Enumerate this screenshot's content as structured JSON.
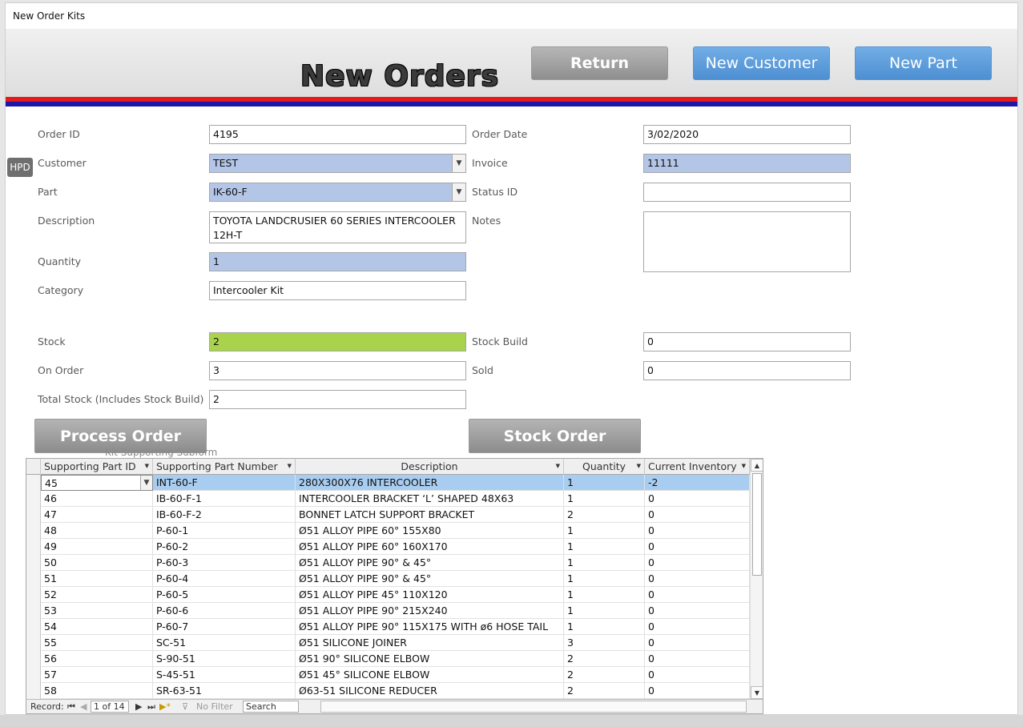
{
  "window": {
    "title": "New Order Kits"
  },
  "header": {
    "title": "New Orders",
    "buttons": {
      "return": "Return",
      "new_customer": "New Customer",
      "new_part": "New Part"
    }
  },
  "side_tab": "HPD",
  "form": {
    "order_id": {
      "label": "Order ID",
      "value": "4195"
    },
    "order_date": {
      "label": "Order Date",
      "value": "3/02/2020"
    },
    "customer": {
      "label": "Customer",
      "value": "TEST"
    },
    "invoice": {
      "label": "Invoice",
      "value": "11111"
    },
    "part": {
      "label": "Part",
      "value": "IK-60-F"
    },
    "status_id": {
      "label": "Status ID",
      "value": ""
    },
    "description": {
      "label": "Description",
      "value": "TOYOTA LANDCRUSIER 60 SERIES INTERCOOLER 12H-T"
    },
    "notes": {
      "label": "Notes",
      "value": ""
    },
    "quantity": {
      "label": "Quantity",
      "value": "1"
    },
    "category": {
      "label": "Category",
      "value": "Intercooler Kit"
    },
    "stock": {
      "label": "Stock",
      "value": "2"
    },
    "stock_build": {
      "label": "Stock Build",
      "value": "0"
    },
    "on_order": {
      "label": "On Order",
      "value": "3"
    },
    "sold": {
      "label": "Sold",
      "value": "0"
    },
    "total_stock": {
      "label": "Total Stock (Includes Stock Build)",
      "value": "2"
    }
  },
  "actions": {
    "process_order": "Process Order",
    "stock_order": "Stock Order"
  },
  "subform": {
    "caption": "Kit Supporting Subform",
    "columns": [
      "Supporting Part ID",
      "Supporting Part Number",
      "Description",
      "Quantity",
      "Current Inventory"
    ],
    "rows": [
      [
        "45",
        "INT-60-F",
        "280X300X76 INTERCOOLER",
        "1",
        "-2"
      ],
      [
        "46",
        "IB-60-F-1",
        "INTERCOOLER BRACKET ‘L’ SHAPED 48X63",
        "1",
        "0"
      ],
      [
        "47",
        "IB-60-F-2",
        "BONNET LATCH SUPPORT BRACKET",
        "2",
        "0"
      ],
      [
        "48",
        "P-60-1",
        "Ø51 ALLOY PIPE 60° 155X80",
        "1",
        "0"
      ],
      [
        "49",
        "P-60-2",
        "Ø51 ALLOY PIPE 60° 160X170",
        "1",
        "0"
      ],
      [
        "50",
        "P-60-3",
        "Ø51 ALLOY PIPE 90° & 45°",
        "1",
        "0"
      ],
      [
        "51",
        "P-60-4",
        "Ø51 ALLOY PIPE 90° & 45°",
        "1",
        "0"
      ],
      [
        "52",
        "P-60-5",
        "Ø51 ALLOY PIPE 45° 110X120",
        "1",
        "0"
      ],
      [
        "53",
        "P-60-6",
        "Ø51 ALLOY PIPE 90° 215X240",
        "1",
        "0"
      ],
      [
        "54",
        "P-60-7",
        "Ø51 ALLOY PIPE 90° 115X175 WITH ø6 HOSE TAIL",
        "1",
        "0"
      ],
      [
        "55",
        "SC-51",
        "Ø51 SILICONE JOINER",
        "3",
        "0"
      ],
      [
        "56",
        "S-90-51",
        "Ø51 90° SILICONE ELBOW",
        "2",
        "0"
      ],
      [
        "57",
        "S-45-51",
        "Ø51 45° SILICONE ELBOW",
        "2",
        "0"
      ],
      [
        "58",
        "SR-63-51",
        "Ø63-51 SILICONE REDUCER",
        "2",
        "0"
      ]
    ],
    "nav": {
      "record_label": "Record:",
      "position": "1 of 14",
      "filter": "No Filter",
      "search": "Search"
    }
  },
  "colors": {
    "field_blue": "#b4c6e7",
    "stock_green": "#a9d34d",
    "selected_row": "#a9cdf0",
    "stripe_red": "#e41b1b",
    "stripe_blue": "#1c17a8"
  }
}
